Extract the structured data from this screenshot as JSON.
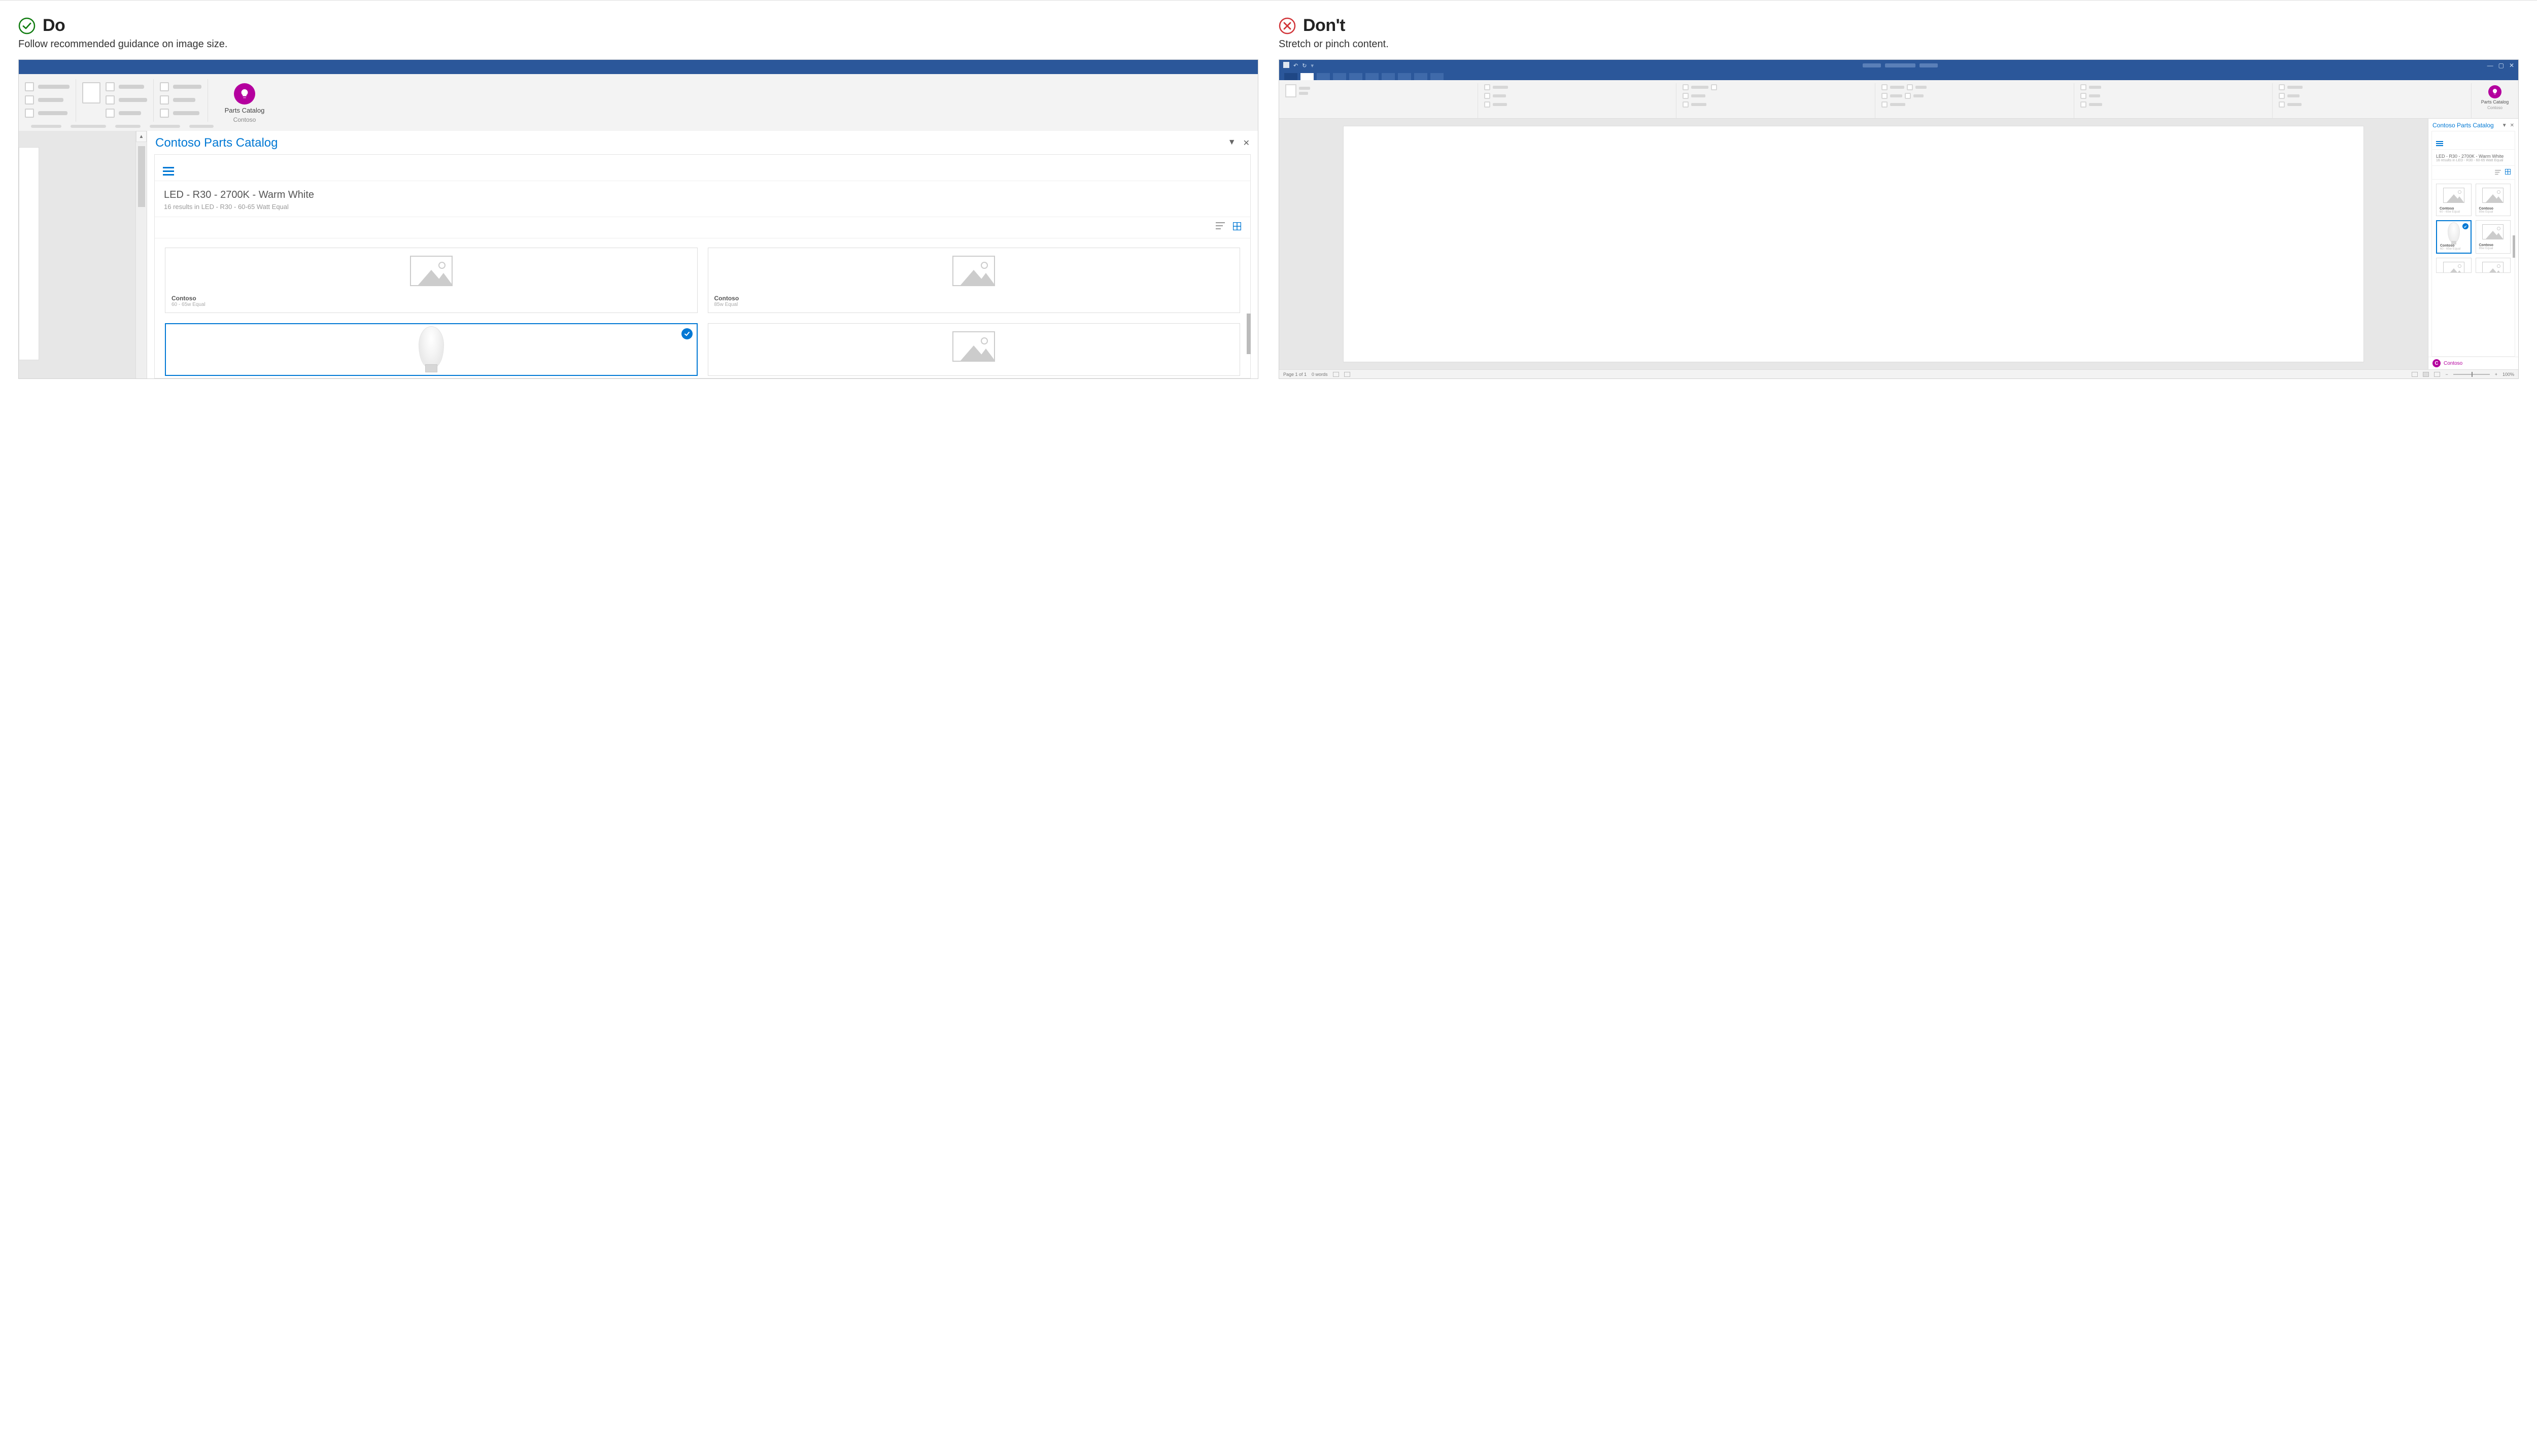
{
  "do": {
    "heading": "Do",
    "subtitle": "Follow recommended guidance on image size.",
    "addin": {
      "label1": "Parts Catalog",
      "label2": "Contoso"
    },
    "taskpane": {
      "title": "Contoso Parts Catalog",
      "breadcrumb_main": "LED - R30 - 2700K - Warm White",
      "breadcrumb_sub": "16 results in LED - R30 - 60-65 Watt Equal",
      "cards": [
        {
          "brand": "Contoso",
          "desc": "60 - 65w Equal"
        },
        {
          "brand": "Contoso",
          "desc": "85w Equal"
        }
      ]
    }
  },
  "dont": {
    "heading": "Don't",
    "subtitle": "Stretch or pinch content.",
    "addin": {
      "label1": "Parts Catalog",
      "label2": "Contoso"
    },
    "taskpane": {
      "title": "Contoso Parts Catalog",
      "breadcrumb_main": "LED - R30 - 2700K - Warm White",
      "breadcrumb_sub": "16 results in LED - R30 - 60-65 Watt Equal",
      "cards": [
        {
          "brand": "Contoso",
          "desc": "60 - 65w Equal"
        },
        {
          "brand": "Contoso",
          "desc": "85w Equal"
        },
        {
          "brand": "Contoso",
          "desc": "60 - 65w Equal"
        },
        {
          "brand": "Contoso",
          "desc": "85w Equal"
        }
      ],
      "footer_brand": "Contoso",
      "footer_avatar": "C"
    },
    "status": {
      "page": "Page 1 of 1",
      "words": "0 words",
      "zoom": "100%"
    }
  }
}
